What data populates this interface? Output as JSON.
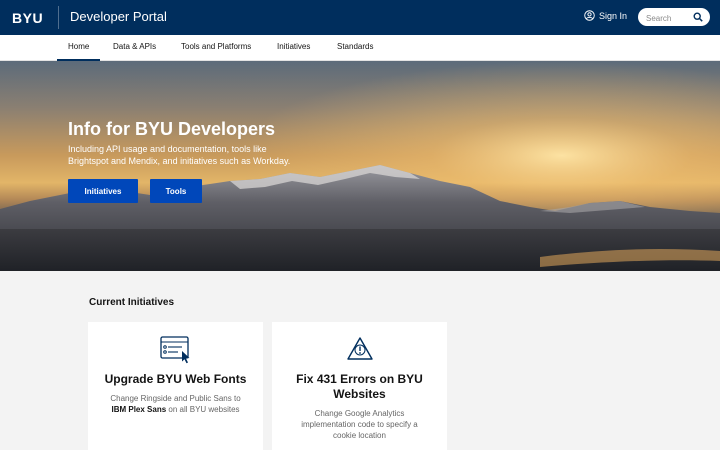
{
  "header": {
    "logo": "BYU",
    "app_title": "Developer Portal",
    "sign_in_label": "Sign In",
    "search_placeholder": "Search"
  },
  "nav": {
    "items": [
      {
        "label": "Home",
        "active": true
      },
      {
        "label": "Data & APIs"
      },
      {
        "label": "Tools and Platforms"
      },
      {
        "label": "Initiatives"
      },
      {
        "label": "Standards"
      }
    ]
  },
  "hero": {
    "title": "Info for BYU Developers",
    "subtitle": "Including API usage and documentation, tools like Brightspot and Mendix, and initiatives such as Workday.",
    "buttons": [
      "Initiatives",
      "Tools"
    ]
  },
  "initiatives": {
    "heading": "Current Initiatives",
    "cards": [
      {
        "icon": "web-form-cursor-icon",
        "title": "Upgrade BYU Web Fonts",
        "desc_pre": "Change Ringside and Public Sans to ",
        "desc_bold": "IBM Plex Sans",
        "desc_post": " on all BYU websites"
      },
      {
        "icon": "warning-triangle-icon",
        "title": "Fix 431 Errors on BYU Websites",
        "desc": "Change Google Analytics implementation code to specify a cookie location"
      }
    ]
  },
  "colors": {
    "brand_navy": "#002e5d",
    "button_blue": "#0047ba"
  }
}
